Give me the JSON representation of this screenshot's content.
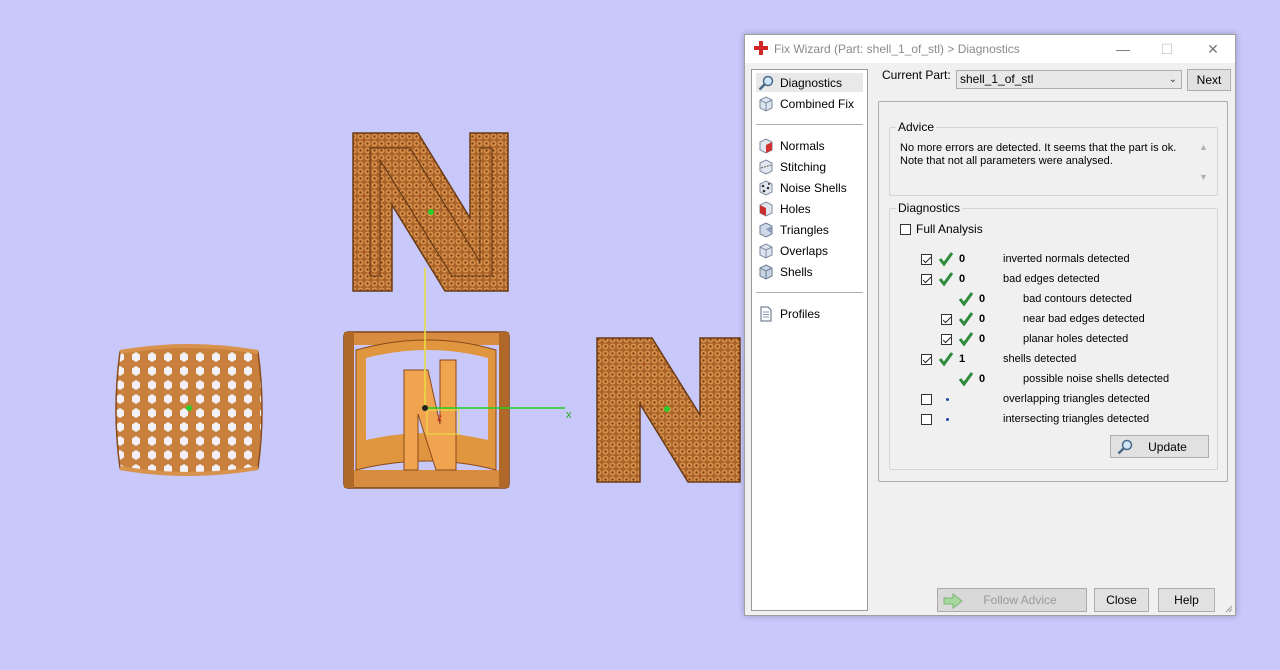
{
  "window": {
    "title": "Fix Wizard (Part: shell_1_of_stl) > Diagnostics",
    "minimize_glyph": "—",
    "maximize_glyph": "☐",
    "close_glyph": "✕"
  },
  "nav": {
    "items": [
      {
        "label": "Diagnostics",
        "icon": "magnifier-icon"
      },
      {
        "label": "Combined Fix",
        "icon": "cube-icon"
      },
      {
        "label": "Normals",
        "icon": "normals-cube-icon"
      },
      {
        "label": "Stitching",
        "icon": "stitching-cube-icon"
      },
      {
        "label": "Noise Shells",
        "icon": "noise-shells-icon"
      },
      {
        "label": "Holes",
        "icon": "holes-cube-icon"
      },
      {
        "label": "Triangles",
        "icon": "triangles-cube-icon"
      },
      {
        "label": "Overlaps",
        "icon": "overlaps-cube-icon"
      },
      {
        "label": "Shells",
        "icon": "shells-cube-icon"
      },
      {
        "label": "Profiles",
        "icon": "document-icon"
      }
    ]
  },
  "part": {
    "label": "Current Part:",
    "value": "shell_1_of_stl",
    "next_label": "Next"
  },
  "advice": {
    "title": "Advice",
    "line1": "No more errors are detected. It seems that the part is ok.",
    "line2": "Note that not all parameters were analysed."
  },
  "diagnostics": {
    "title": "Diagnostics",
    "full_analysis_label": "Full Analysis",
    "rows": [
      {
        "checkbox": "checked",
        "status": "ok",
        "count": "0",
        "label": "inverted normals detected"
      },
      {
        "checkbox": "checked",
        "status": "ok",
        "count": "0",
        "label": "bad edges detected"
      },
      {
        "checkbox": "none",
        "status": "ok",
        "count": "0",
        "label": "bad contours detected"
      },
      {
        "checkbox": "checked",
        "status": "ok",
        "count": "0",
        "label": "near bad edges detected"
      },
      {
        "checkbox": "checked",
        "status": "ok",
        "count": "0",
        "label": "planar holes detected"
      },
      {
        "checkbox": "checked",
        "status": "ok",
        "count": "1",
        "label": "shells detected"
      },
      {
        "checkbox": "none",
        "status": "ok",
        "count": "0",
        "label": "possible noise shells detected"
      },
      {
        "checkbox": "unchecked",
        "status": "unknown",
        "count": "",
        "label": "overlapping triangles detected"
      },
      {
        "checkbox": "unchecked",
        "status": "unknown",
        "count": "",
        "label": "intersecting triangles detected"
      }
    ],
    "update_label": "Update"
  },
  "footer": {
    "follow_advice_label": "Follow Advice",
    "close_label": "Close",
    "help_label": "Help"
  },
  "viewport": {
    "axis_x_label": "x",
    "axis_z_label": "z",
    "letter": "N"
  },
  "colors": {
    "background": "#c8c8fa",
    "part_orange": "#c87a38",
    "check_green": "#2e8b3a",
    "axis_green": "#22cc22",
    "axis_yellow": "#e8e040"
  }
}
